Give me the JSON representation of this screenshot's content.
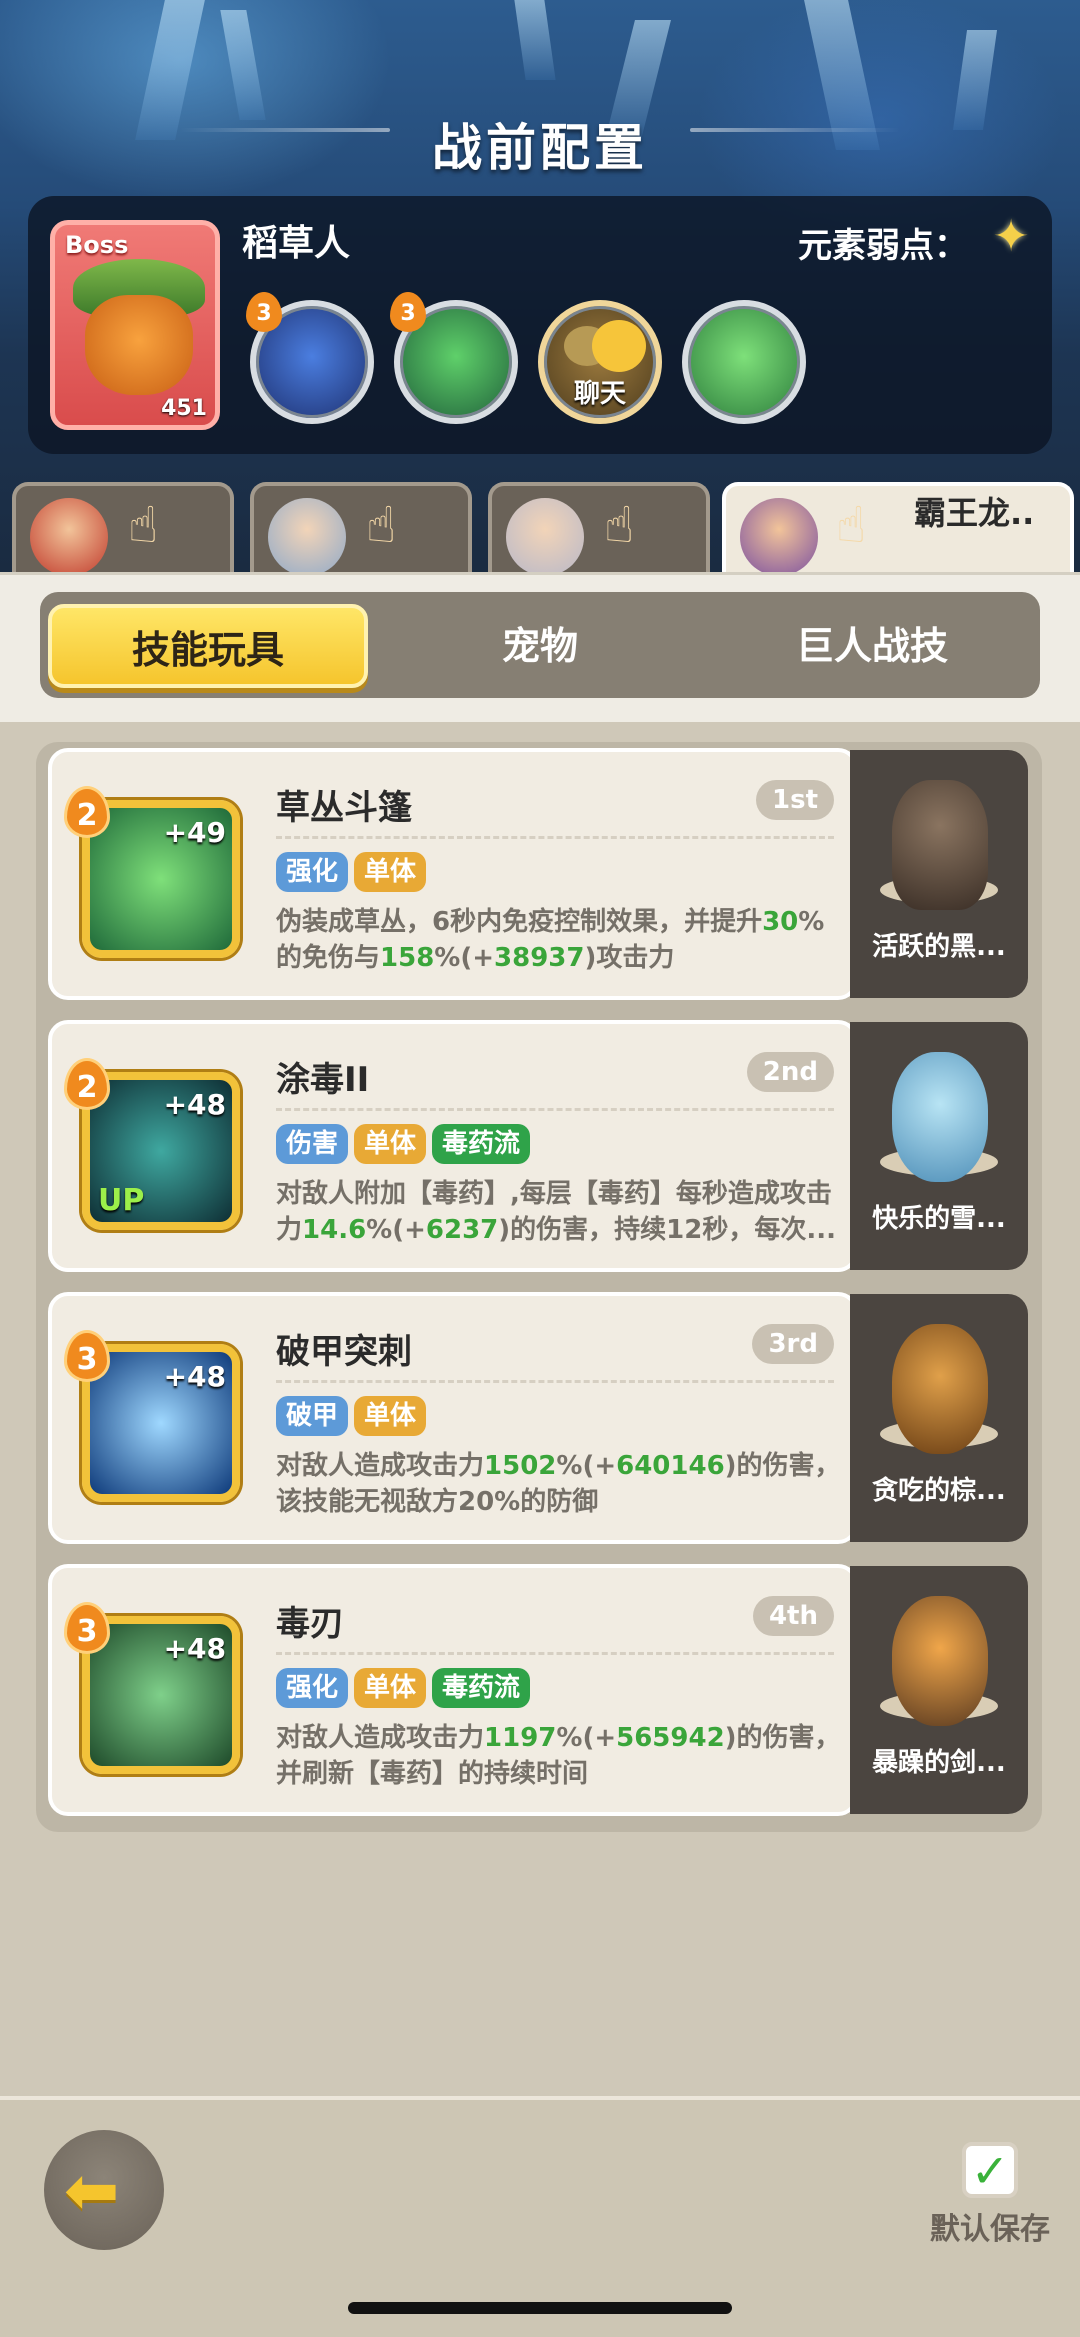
{
  "header": {
    "title": "战前配置"
  },
  "boss": {
    "tag": "Boss",
    "name": "稻草人",
    "level": "451",
    "weakness_label": "元素弱点：",
    "weakness_icon": "star-sparkle-icon",
    "skills": [
      {
        "level": "3",
        "icon": "bat-wing-skill-icon"
      },
      {
        "level": "3",
        "icon": "wind-leaf-skill-icon"
      },
      {
        "label": "聊天",
        "icon": "chat-bubble-icon"
      },
      {
        "icon": "green-slime-skill-icon"
      }
    ]
  },
  "hero_tabs": [
    {
      "icon": "hero-avatar-red"
    },
    {
      "icon": "hero-avatar-silver"
    },
    {
      "icon": "hero-avatar-white"
    },
    {
      "label": "霸王龙..",
      "icon": "hero-avatar-purple",
      "active": true
    }
  ],
  "category_tabs": [
    "技能玩具",
    "宠物",
    "巨人战技"
  ],
  "skills": [
    {
      "level": "2",
      "plus": "+49",
      "name": "草丛斗篷",
      "rank": "1st",
      "tags": [
        "强化",
        "单体"
      ],
      "desc_a": "伪装成草丛，6秒内免疫控制效果，并提升",
      "desc_b": "30",
      "desc_c": "%的免伤与",
      "desc_d": "158",
      "desc_e": "%(+",
      "desc_f": "38937",
      "desc_g": ")攻击力",
      "pet": "活跃的黑..."
    },
    {
      "level": "2",
      "plus": "+48",
      "up": "UP",
      "name": "涂毒II",
      "rank": "2nd",
      "tags": [
        "伤害",
        "单体",
        "毒药流"
      ],
      "desc_a": "对敌人附加【毒药】,每层【毒药】每秒造成攻击力",
      "desc_b": "14.6",
      "desc_c": "%(+",
      "desc_d": "6237",
      "desc_e": ")的伤害，持续12秒，每次...",
      "pet": "快乐的雪..."
    },
    {
      "level": "3",
      "plus": "+48",
      "name": "破甲突刺",
      "rank": "3rd",
      "tags": [
        "破甲",
        "单体"
      ],
      "desc_a": "对敌人造成攻击力",
      "desc_b": "1502",
      "desc_c": "%(+",
      "desc_d": "640146",
      "desc_e": ")的伤害，该技能无视敌方20%的防御",
      "pet": "贪吃的棕..."
    },
    {
      "level": "3",
      "plus": "+48",
      "name": "毒刃",
      "rank": "4th",
      "tags": [
        "强化",
        "单体",
        "毒药流"
      ],
      "desc_a": "对敌人造成攻击力",
      "desc_b": "1197",
      "desc_c": "%(+",
      "desc_d": "565942",
      "desc_e": ")的伤害，并刷新【毒药】的持续时间",
      "pet": "暴躁的剑..."
    }
  ],
  "footer": {
    "back_icon": "back-arrow-icon",
    "save_label": "默认保存",
    "save_icon": "checkbox-checked-icon"
  },
  "colors": {
    "accent": "#f5c52d",
    "highlight": "#3aa53a",
    "tag_blue": "#5d9ad8",
    "tag_gold": "#e8a935",
    "tag_green": "#2fa349"
  }
}
